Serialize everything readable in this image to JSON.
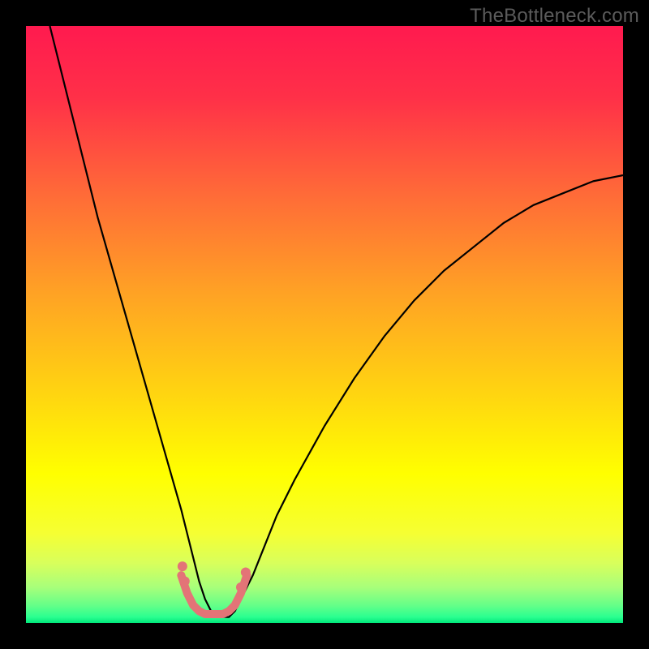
{
  "watermark": "TheBottleneck.com",
  "chart_data": {
    "type": "line",
    "title": "",
    "xlabel": "",
    "ylabel": "",
    "xlim": [
      0,
      100
    ],
    "ylim": [
      0,
      100
    ],
    "background_gradient_stops": [
      {
        "pos": 0.0,
        "color": "#ff1a4f"
      },
      {
        "pos": 0.12,
        "color": "#ff3048"
      },
      {
        "pos": 0.28,
        "color": "#ff6a38"
      },
      {
        "pos": 0.45,
        "color": "#ffa324"
      },
      {
        "pos": 0.62,
        "color": "#ffd610"
      },
      {
        "pos": 0.75,
        "color": "#ffff00"
      },
      {
        "pos": 0.85,
        "color": "#f5ff33"
      },
      {
        "pos": 0.9,
        "color": "#d8ff5c"
      },
      {
        "pos": 0.94,
        "color": "#a8ff7a"
      },
      {
        "pos": 0.97,
        "color": "#66ff88"
      },
      {
        "pos": 0.99,
        "color": "#2aff90"
      },
      {
        "pos": 1.0,
        "color": "#00e77a"
      }
    ],
    "series": [
      {
        "name": "bottleneck-curve",
        "stroke": "#000000",
        "stroke_width": 2.2,
        "x": [
          4,
          6,
          8,
          10,
          12,
          14,
          16,
          18,
          20,
          22,
          24,
          26,
          27,
          28,
          29,
          30,
          31,
          32,
          33,
          34,
          35,
          36,
          38,
          40,
          42,
          45,
          50,
          55,
          60,
          65,
          70,
          75,
          80,
          85,
          90,
          95,
          100
        ],
        "y": [
          100,
          92,
          84,
          76,
          68,
          61,
          54,
          47,
          40,
          33,
          26,
          19,
          15,
          11,
          7,
          4,
          2,
          1,
          1,
          1,
          2,
          4,
          8,
          13,
          18,
          24,
          33,
          41,
          48,
          54,
          59,
          63,
          67,
          70,
          72,
          74,
          75
        ]
      },
      {
        "name": "trough-marker",
        "stroke": "#e37477",
        "stroke_width": 10,
        "linecap": "round",
        "x": [
          26,
          27,
          28,
          29,
          30,
          31,
          32,
          33,
          34,
          35,
          36,
          37
        ],
        "y": [
          8,
          5,
          3,
          2,
          1.5,
          1.5,
          1.5,
          1.5,
          2,
          3,
          5,
          8
        ]
      }
    ],
    "trough_dots": {
      "stroke": "#e37477",
      "r": 6,
      "points": [
        {
          "x": 26.2,
          "y": 9.5
        },
        {
          "x": 26.6,
          "y": 7.0
        },
        {
          "x": 36.0,
          "y": 6.0
        },
        {
          "x": 36.8,
          "y": 8.5
        }
      ]
    }
  }
}
